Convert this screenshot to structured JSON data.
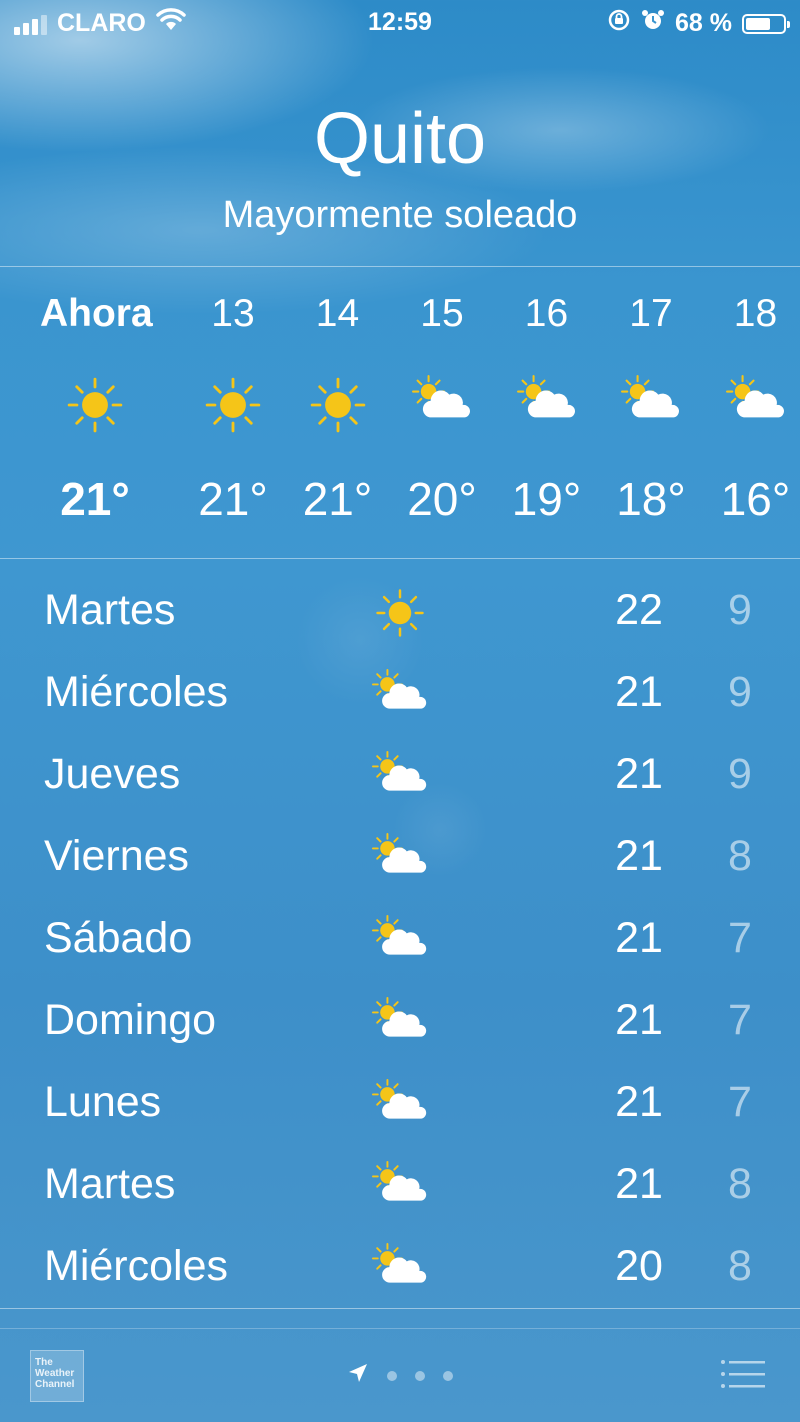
{
  "status": {
    "carrier": "CLARO",
    "time": "12:59",
    "battery_percent": "68 %",
    "battery_level": 0.68
  },
  "header": {
    "city": "Quito",
    "condition": "Mayormente soleado"
  },
  "hourly": [
    {
      "label": "Ahora",
      "icon": "sun-icon",
      "temp": "21°"
    },
    {
      "label": "13",
      "icon": "sun-icon",
      "temp": "21°"
    },
    {
      "label": "14",
      "icon": "sun-icon",
      "temp": "21°"
    },
    {
      "label": "15",
      "icon": "partly-cloudy-icon",
      "temp": "20°"
    },
    {
      "label": "16",
      "icon": "partly-cloudy-icon",
      "temp": "19°"
    },
    {
      "label": "17",
      "icon": "partly-cloudy-icon",
      "temp": "18°"
    },
    {
      "label": "18",
      "icon": "partly-cloudy-icon",
      "temp": "16°"
    }
  ],
  "daily": [
    {
      "day": "Martes",
      "icon": "sun-icon",
      "high": "22",
      "low": "9"
    },
    {
      "day": "Miércoles",
      "icon": "partly-cloudy-icon",
      "high": "21",
      "low": "9"
    },
    {
      "day": "Jueves",
      "icon": "partly-cloudy-icon",
      "high": "21",
      "low": "9"
    },
    {
      "day": "Viernes",
      "icon": "partly-cloudy-icon",
      "high": "21",
      "low": "8"
    },
    {
      "day": "Sábado",
      "icon": "partly-cloudy-icon",
      "high": "21",
      "low": "7"
    },
    {
      "day": "Domingo",
      "icon": "partly-cloudy-icon",
      "high": "21",
      "low": "7"
    },
    {
      "day": "Lunes",
      "icon": "partly-cloudy-icon",
      "high": "21",
      "low": "7"
    },
    {
      "day": "Martes",
      "icon": "partly-cloudy-icon",
      "high": "21",
      "low": "8"
    },
    {
      "day": "Miércoles",
      "icon": "partly-cloudy-icon",
      "high": "20",
      "low": "8"
    }
  ],
  "footer": {
    "provider_logo": "The Weather Channel",
    "page_count": 3,
    "icons": {
      "location": "location-arrow-icon",
      "list": "list-icon"
    }
  },
  "colors": {
    "sun": "#f5c518",
    "cloud": "#ffffff",
    "background": "#3a95cf"
  }
}
